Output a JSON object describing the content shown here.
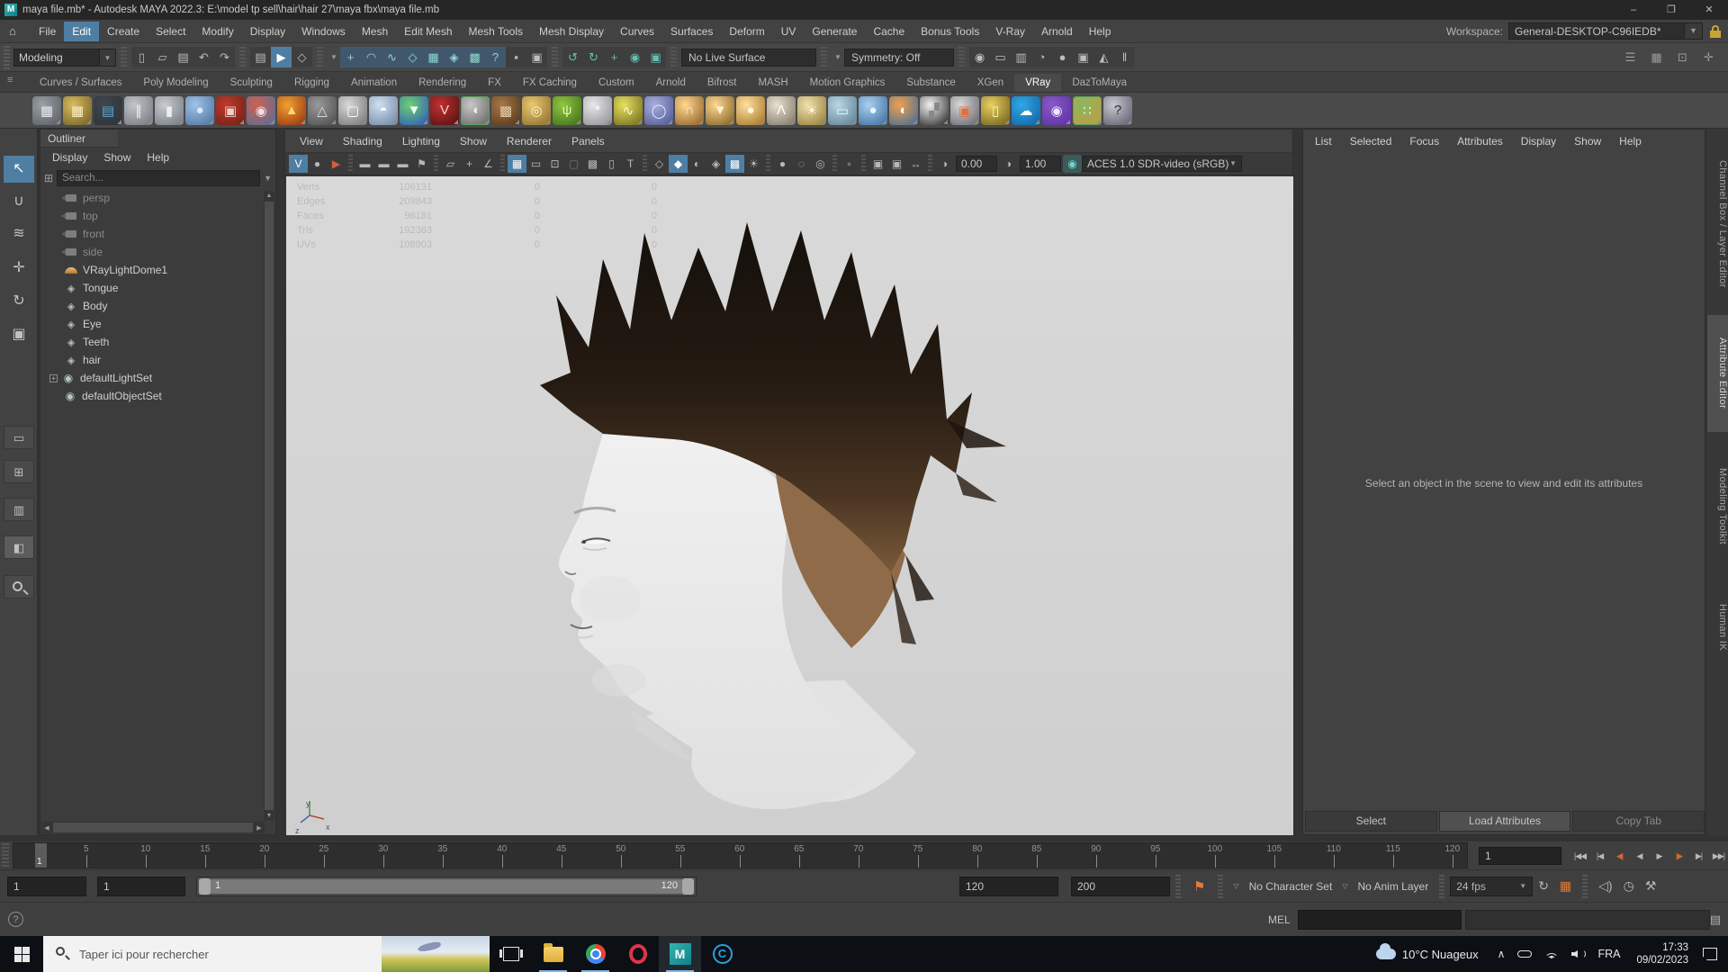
{
  "colors": {
    "accent": "#4f7ea3",
    "teal": "#62c0b2",
    "viewport_bg": "#d4d4d4",
    "taskbar_bg": "#0c0f13",
    "orange": "#e07b39"
  },
  "titlebar": {
    "title": "maya file.mb* - Autodesk MAYA 2022.3: E:\\model tp sell\\hair\\hair 27\\maya fbx\\maya file.mb",
    "minimize": "–",
    "maximize": "❐",
    "close": "✕"
  },
  "menubar": {
    "items": [
      "File",
      "Edit",
      "Create",
      "Select",
      "Modify",
      "Display",
      "Windows",
      "Mesh",
      "Edit Mesh",
      "Mesh Tools",
      "Mesh Display",
      "Curves",
      "Surfaces",
      "Deform",
      "UV",
      "Generate",
      "Cache",
      "Bonus Tools",
      "V-Ray",
      "Arnold",
      "Help"
    ],
    "active": "Edit",
    "workspace_label": "Workspace:",
    "workspace_value": "General-DESKTOP-C96IEDB*"
  },
  "statusline": {
    "mode": "Modeling",
    "live_surface": "No Live Surface",
    "symmetry": "Symmetry: Off",
    "groups": [
      {
        "items": [
          {
            "n": "file-new",
            "g": "▯"
          },
          {
            "n": "file-open",
            "g": "▱"
          },
          {
            "n": "file-save",
            "g": "▤"
          },
          {
            "n": "undo",
            "g": "↶"
          },
          {
            "n": "redo",
            "g": "↷"
          }
        ]
      },
      {
        "items": [
          {
            "n": "select-hierarchy",
            "g": "▤"
          },
          {
            "n": "select-object",
            "g": "▶",
            "on": true
          },
          {
            "n": "select-component",
            "g": "◇"
          }
        ]
      },
      {
        "drop": true,
        "items": [
          {
            "n": "snap-grid",
            "g": "+",
            "snap": true
          },
          {
            "n": "snap-curve",
            "g": "◠",
            "snap": true
          },
          {
            "n": "snap-point",
            "g": "∿",
            "snap": true
          },
          {
            "n": "snap-view-plane",
            "g": "◇",
            "snap": true
          },
          {
            "n": "snap-surface",
            "g": "▦",
            "snap": true
          },
          {
            "n": "snap-center",
            "g": "◈",
            "snap": true
          },
          {
            "n": "snap-film",
            "g": "▩",
            "snap": true
          },
          {
            "n": "snap-help",
            "g": "?",
            "snap": true
          },
          {
            "n": "lock-selection",
            "g": "▪"
          },
          {
            "n": "highlight-selection",
            "g": "▣"
          }
        ]
      },
      {
        "items": [
          {
            "n": "history-input",
            "g": "↺",
            "teal": true
          },
          {
            "n": "history-output",
            "g": "↻",
            "teal": true
          },
          {
            "n": "construction-history",
            "g": "+",
            "teal": true
          },
          {
            "n": "history-node",
            "g": "◉",
            "teal": true
          },
          {
            "n": "history-plane",
            "g": "▣",
            "teal": true
          }
        ]
      },
      {
        "field": "live_surface",
        "w": 150
      },
      {
        "drop": true,
        "field": "symmetry",
        "w": 122
      },
      {
        "items": [
          {
            "n": "render-view",
            "g": "◉"
          },
          {
            "n": "render-current-frame",
            "g": "▭"
          },
          {
            "n": "ipr-render",
            "g": "▥"
          },
          {
            "n": "render-settings",
            "g": "◔"
          },
          {
            "n": "display-toggle",
            "g": "●",
            "tealon": true
          },
          {
            "n": "render-sequence",
            "g": "▣"
          },
          {
            "n": "launch-render",
            "g": "◭"
          },
          {
            "n": "pause-viewport",
            "g": "‖"
          }
        ]
      }
    ],
    "right_icons": [
      {
        "n": "sidebar-menu",
        "g": "☰"
      },
      {
        "n": "attribute-editor-toggle",
        "g": "▦"
      },
      {
        "n": "tool-settings-toggle",
        "g": "⊡"
      },
      {
        "n": "channel-box-toggle",
        "g": "✛"
      }
    ]
  },
  "shelf": {
    "active": "VRay",
    "tabs": [
      "Curves / Surfaces",
      "Poly Modeling",
      "Sculpting",
      "Rigging",
      "Animation",
      "Rendering",
      "FX",
      "FX Caching",
      "Custom",
      "Arnold",
      "Bifrost",
      "MASH",
      "Motion Graphics",
      "Substance",
      "XGen",
      "VRay",
      "DazToMaya"
    ],
    "icons": [
      {
        "n": "vrmesh-export",
        "g": "▦",
        "c1": "#9aa0a6",
        "c2": "#565b60",
        "fg": "#e8ecf0"
      },
      {
        "n": "vrmesh-export-folder",
        "g": "▦",
        "c1": "#d8bc5e",
        "c2": "#6e5c24",
        "fg": "#fff0c0"
      },
      {
        "n": "vrmesh-import",
        "g": "▤",
        "c1": "#3f464d",
        "c2": "#2c3238",
        "fg": "#5fa8d6"
      },
      {
        "n": "vray-plug",
        "g": "∥",
        "c1": "#c2c6cc",
        "c2": "#6f747a",
        "fg": "#f0f0f0"
      },
      {
        "n": "vray-proxy",
        "g": "▮",
        "c1": "#c8ccd2",
        "c2": "#70757c",
        "fg": "#eeeeee"
      },
      {
        "n": "vray-wrapper",
        "g": "●",
        "c1": "#9fc3ea",
        "c2": "#4a6f9a",
        "fg": "#dce9f8"
      },
      {
        "n": "vray-physical-camera",
        "g": "▣",
        "c1": "#c0392b",
        "c2": "#6e1f16",
        "fg": "#f0d0c8"
      },
      {
        "n": "vray-blend-spheres",
        "g": "◉",
        "c1": "#d06050",
        "c2": "#4f6f9f",
        "fg": "#f0e0e0"
      },
      {
        "n": "vray-fire",
        "g": "▲",
        "c1": "#f0a030",
        "c2": "#903010",
        "fg": "#ffd870"
      },
      {
        "n": "vray-pyramid-wire",
        "g": "△",
        "c1": "#9a9a9a",
        "c2": "#4a4a4a",
        "fg": "#dddddd"
      },
      {
        "n": "vray-softbox",
        "g": "▢",
        "c1": "#d8d8d8",
        "c2": "#707070",
        "fg": "#ffffff"
      },
      {
        "n": "vray-cone-sphere",
        "g": "◓",
        "c1": "#cfe0f0",
        "c2": "#6a82a0",
        "fg": "#ffffff"
      },
      {
        "n": "vray-ies-light",
        "g": "▼",
        "c1": "#6fd070",
        "c2": "#2a52c0",
        "fg": "#eaffea"
      },
      {
        "n": "vray-logo",
        "g": "V",
        "c1": "#c03030",
        "c2": "#501010",
        "fg": "#ffd0d0"
      },
      {
        "n": "vray-dome-selected",
        "g": "◖",
        "c1": "#c8c8c8",
        "c2": "#606060",
        "fg": "#f0f0f0",
        "bracket": true
      },
      {
        "n": "vray-bitmap",
        "g": "▩",
        "c1": "#a87848",
        "c2": "#503418",
        "fg": "#e8d0b0"
      },
      {
        "n": "vray-sphere-wire",
        "g": "◎",
        "c1": "#e8c870",
        "c2": "#8a6a28",
        "fg": "#fff4d0"
      },
      {
        "n": "vray-fur-grass",
        "g": "ψ",
        "c1": "#90c840",
        "c2": "#3a6a18",
        "fg": "#e0f8b0"
      },
      {
        "n": "vray-fuzzball",
        "g": "*",
        "c1": "#e8e8ea",
        "c2": "#8a8a90",
        "fg": "#ffffff"
      },
      {
        "n": "vray-hair-curve",
        "g": "∿",
        "c1": "#e8e060",
        "c2": "#6a6418",
        "fg": "#fffad0"
      },
      {
        "n": "vray-geo-sphere",
        "g": "◯",
        "c1": "#a8b0e0",
        "c2": "#4a5290",
        "fg": "#e8ecff"
      },
      {
        "n": "vray-dome-light",
        "g": "∩",
        "c1": "#ffd890",
        "c2": "#8a5a20",
        "fg": "#fff0d0"
      },
      {
        "n": "vray-rect-light",
        "g": "▼",
        "c1": "#ffd890",
        "c2": "#7a5a20",
        "fg": "#fff0d0"
      },
      {
        "n": "vray-sphere-light",
        "g": "●",
        "c1": "#ffe0a0",
        "c2": "#a07020",
        "fg": "#fff8e0"
      },
      {
        "n": "vray-spot-light",
        "g": "Λ",
        "c1": "#e8e0d0",
        "c2": "#787060",
        "fg": "#ffffff"
      },
      {
        "n": "vray-sun",
        "g": "☀",
        "c1": "#f0e0b0",
        "c2": "#907830",
        "fg": "#fff8d0"
      },
      {
        "n": "vray-plane",
        "g": "▭",
        "c1": "#b8d8e8",
        "c2": "#5a7a8a",
        "fg": "#e8f4fa"
      },
      {
        "n": "vray-sphere-blue",
        "g": "●",
        "c1": "#a8d0f0",
        "c2": "#3a6a9a",
        "fg": "#e8f4ff"
      },
      {
        "n": "vray-mtl-sphere",
        "g": "◐",
        "c1": "#f0a050",
        "c2": "#3a6a9a",
        "fg": "#ffffff"
      },
      {
        "n": "vray-checker",
        "g": "▞",
        "c1": "#f0f0f0",
        "c2": "#202020",
        "fg": "#888888"
      },
      {
        "n": "vray-render-frame",
        "g": "▣",
        "c1": "#d8d8d8",
        "c2": "#606068",
        "fg": "#e07040"
      },
      {
        "n": "vray-light-lister",
        "g": "▯",
        "c1": "#e8d060",
        "c2": "#6a5a18",
        "fg": "#fff8c0"
      },
      {
        "n": "vray-cloud",
        "g": "☁",
        "c1": "#30a8e8",
        "c2": "#1060a0",
        "fg": "#ffffff"
      },
      {
        "n": "vray-toolbar-palette",
        "g": "◉",
        "c1": "#8858c8",
        "c2": "#5a30a0",
        "fg": "#f0e8ff"
      },
      {
        "n": "vray-quad-spheres",
        "g": "∷",
        "c1": "#88b860",
        "c2": "#c89840",
        "fg": "#f0ffd8",
        "bracket": true
      },
      {
        "n": "vray-help",
        "g": "?",
        "c1": "#c8c8d0",
        "c2": "#585868",
        "fg": "#303038"
      }
    ]
  },
  "toolbox": {
    "tools": [
      {
        "n": "select-tool",
        "g": "↖",
        "on": true
      },
      {
        "n": "lasso-tool",
        "g": "∪"
      },
      {
        "n": "paint-select-tool",
        "g": "≋"
      },
      {
        "n": "move-tool",
        "g": "✛"
      },
      {
        "n": "rotate-tool",
        "g": "↻"
      },
      {
        "n": "scale-tool",
        "g": "▣"
      }
    ],
    "layouts": [
      {
        "n": "layout-single",
        "g": "▭"
      },
      {
        "n": "layout-four",
        "g": "⊞"
      },
      {
        "n": "layout-split",
        "g": "▥"
      },
      {
        "n": "layout-outliner-persp",
        "g": "◧",
        "lit": true
      },
      {
        "n": "layout-zoom",
        "g": "",
        "zoom": true
      }
    ]
  },
  "outliner": {
    "tab": "Outliner",
    "menus": [
      "Display",
      "Show",
      "Help"
    ],
    "search_placeholder": "Search...",
    "items": [
      {
        "label": "persp",
        "icon": "camera",
        "grayed": true,
        "indent": 1
      },
      {
        "label": "top",
        "icon": "camera",
        "grayed": true,
        "indent": 1
      },
      {
        "label": "front",
        "icon": "camera",
        "grayed": true,
        "indent": 1
      },
      {
        "label": "side",
        "icon": "camera",
        "grayed": true,
        "indent": 1
      },
      {
        "label": "VRayLightDome1",
        "icon": "dome",
        "indent": 1
      },
      {
        "label": "Tongue",
        "icon": "mesh",
        "indent": 1
      },
      {
        "label": "Body",
        "icon": "mesh",
        "indent": 1
      },
      {
        "label": "Eye",
        "icon": "mesh",
        "indent": 1
      },
      {
        "label": "Teeth",
        "icon": "mesh",
        "indent": 1
      },
      {
        "label": "hair",
        "icon": "mesh",
        "indent": 1
      },
      {
        "label": "defaultLightSet",
        "icon": "set",
        "expand": true,
        "indent": 0
      },
      {
        "label": "defaultObjectSet",
        "icon": "set",
        "indent": 0
      }
    ]
  },
  "viewport": {
    "menus": [
      "View",
      "Shading",
      "Lighting",
      "Show",
      "Renderer",
      "Panels"
    ],
    "toolbar": [
      {
        "t": "icon",
        "n": "vray-frame-buffer",
        "g": "V",
        "on": true
      },
      {
        "t": "icon",
        "n": "smooth-shade-sphere",
        "g": "●"
      },
      {
        "t": "icon",
        "n": "select-pointer",
        "g": "▶",
        "fg": "#d06040"
      },
      {
        "t": "sep"
      },
      {
        "t": "icon",
        "n": "select-camera",
        "g": "▬"
      },
      {
        "t": "icon",
        "n": "lock-camera",
        "g": "▬"
      },
      {
        "t": "icon",
        "n": "camera-attributes",
        "g": "▬"
      },
      {
        "t": "icon",
        "n": "bookmark",
        "g": "⚑"
      },
      {
        "t": "sep"
      },
      {
        "t": "icon",
        "n": "image-plane",
        "g": "▱"
      },
      {
        "t": "icon",
        "n": "pan-zoom-2d",
        "g": "+"
      },
      {
        "t": "icon",
        "n": "oblique-tool",
        "g": "∠"
      },
      {
        "t": "sep"
      },
      {
        "t": "icon",
        "n": "grid-toggle",
        "g": "▦",
        "on": true
      },
      {
        "t": "icon",
        "n": "film-gate",
        "g": "▭"
      },
      {
        "t": "icon",
        "n": "resolution-gate",
        "g": "⊡"
      },
      {
        "t": "icon",
        "n": "gate-mask",
        "g": "▢",
        "dim": true
      },
      {
        "t": "icon",
        "n": "field-chart",
        "g": "▩"
      },
      {
        "t": "icon",
        "n": "safe-action",
        "g": "▯"
      },
      {
        "t": "icon",
        "n": "safe-title",
        "g": "T"
      },
      {
        "t": "sep"
      },
      {
        "t": "icon",
        "n": "wireframe-mode",
        "g": "◇"
      },
      {
        "t": "icon",
        "n": "shaded-mode",
        "g": "◆",
        "on": true
      },
      {
        "t": "icon",
        "n": "textured-mode",
        "g": "◐"
      },
      {
        "t": "icon",
        "n": "use-all-lights",
        "g": "◈"
      },
      {
        "t": "icon",
        "n": "shadows-toggle",
        "g": "▩",
        "on": true
      },
      {
        "t": "icon",
        "n": "ambient-occlusion",
        "g": "☀"
      },
      {
        "t": "sep"
      },
      {
        "t": "icon",
        "n": "motion-blur",
        "g": "●"
      },
      {
        "t": "icon",
        "n": "anti-alias",
        "g": "◌"
      },
      {
        "t": "icon",
        "n": "depth-of-field",
        "g": "◎"
      },
      {
        "t": "sep"
      },
      {
        "t": "icon",
        "n": "isolate-select",
        "g": "▫"
      },
      {
        "t": "sep"
      },
      {
        "t": "icon",
        "n": "xray-mode",
        "g": "▣"
      },
      {
        "t": "icon",
        "n": "xray-joints",
        "g": "▣"
      },
      {
        "t": "icon",
        "n": "exposure-reset",
        "g": "↔"
      },
      {
        "t": "sep"
      },
      {
        "t": "icon",
        "n": "exposure-icon",
        "g": "◑"
      },
      {
        "t": "field",
        "bind": "exposure"
      },
      {
        "t": "icon",
        "n": "contrast-icon",
        "g": "◑"
      },
      {
        "t": "field",
        "bind": "gamma"
      },
      {
        "t": "icon",
        "n": "color-managed-icon",
        "g": "◉",
        "tealon": true
      },
      {
        "t": "select",
        "bind": "colorspace"
      }
    ],
    "exposure": "0.00",
    "gamma": "1.00",
    "colorspace": "ACES 1.0 SDR-video (sRGB)",
    "hud": {
      "rows": [
        [
          "Verts",
          "106131",
          "0",
          "0"
        ],
        [
          "Edges",
          "209843",
          "0",
          "0"
        ],
        [
          "Faces",
          "96181",
          "0",
          "0"
        ],
        [
          "Tris",
          "192363",
          "0",
          "0"
        ],
        [
          "UVs",
          "108903",
          "0",
          "0"
        ]
      ]
    },
    "axis": {
      "up": "y",
      "left": "z",
      "right": "x"
    }
  },
  "attribute_editor": {
    "menus": [
      "List",
      "Selected",
      "Focus",
      "Attributes",
      "Display",
      "Show",
      "Help"
    ],
    "message": "Select an object in the scene to view and edit its attributes",
    "buttons": [
      {
        "label": "Select",
        "style": "normal"
      },
      {
        "label": "Load Attributes",
        "style": "lit"
      },
      {
        "label": "Copy Tab",
        "style": "dim"
      }
    ]
  },
  "right_tabs": {
    "active": "Attribute Editor",
    "items": [
      "Channel Box / Layer Editor",
      "Attribute Editor",
      "Modeling Toolkit",
      "Human IK"
    ]
  },
  "timeslider": {
    "current_marker_label": "1",
    "tick_labels": [
      "5",
      "10",
      "15",
      "20",
      "25",
      "30",
      "35",
      "40",
      "45",
      "50",
      "55",
      "60",
      "65",
      "70",
      "75",
      "80",
      "85",
      "90",
      "95",
      "100",
      "105",
      "110",
      "115",
      "120"
    ],
    "current_field": "1",
    "playback": [
      {
        "n": "go-to-start",
        "g": "|◀◀"
      },
      {
        "n": "step-back-key",
        "g": "|◀"
      },
      {
        "n": "step-back-frame",
        "g": "◀|",
        "accent": true
      },
      {
        "n": "play-backwards",
        "g": "◀"
      },
      {
        "n": "play-forwards",
        "g": "▶"
      },
      {
        "n": "step-forward-frame",
        "g": "|▶",
        "accent": true
      },
      {
        "n": "step-forward-key",
        "g": "▶|"
      },
      {
        "n": "go-to-end",
        "g": "▶▶|"
      }
    ]
  },
  "range": {
    "anim_start": "1",
    "playback_start": "1",
    "range_label_start": "1",
    "range_label_end": "120",
    "playback_end": "120",
    "anim_end": "200",
    "character_set": "No Character Set",
    "anim_layer": "No Anim Layer",
    "fps": "24 fps"
  },
  "command_line": {
    "help_icon": "?",
    "label": "MEL"
  },
  "taskbar": {
    "search_placeholder": "Taper ici pour rechercher",
    "apps": [
      {
        "n": "task-view",
        "run": false
      },
      {
        "n": "file-explorer",
        "run": true
      },
      {
        "n": "chrome",
        "run": true
      },
      {
        "n": "opera",
        "run": false
      },
      {
        "n": "maya",
        "run": true,
        "active": true,
        "label": "M"
      },
      {
        "n": "corona",
        "run": false,
        "label": "C"
      }
    ],
    "tray": {
      "temp": "10°C",
      "weather": "Nuageux",
      "chevron": "∧",
      "lang": "FRA",
      "time": "17:33",
      "date": "09/02/2023"
    }
  }
}
